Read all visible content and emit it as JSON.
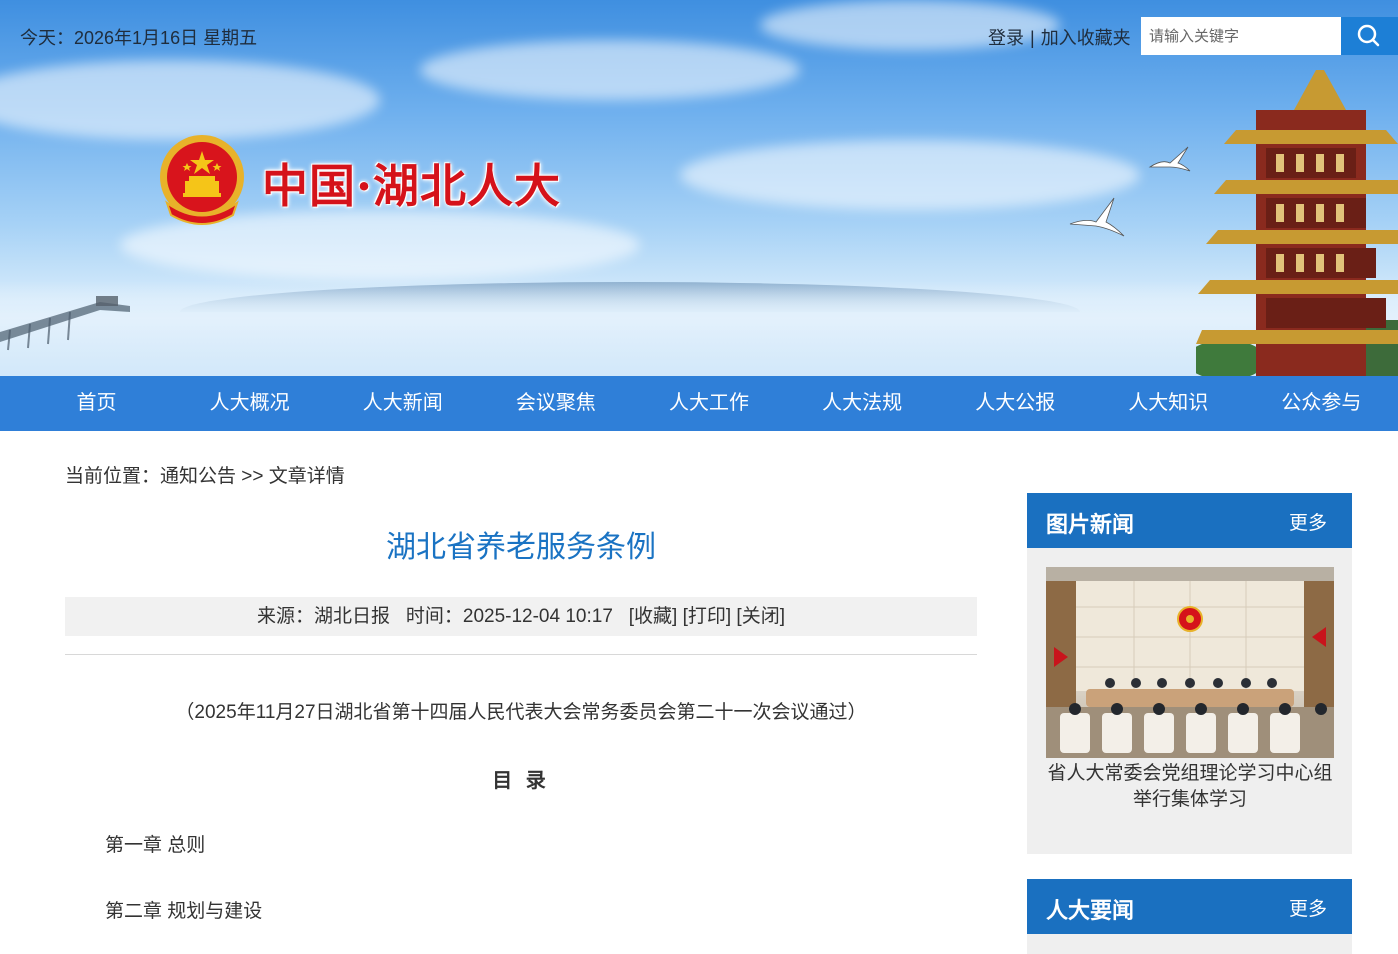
{
  "header": {
    "date": "今天：2026年1月16日 星期五",
    "login": "登录",
    "separator": "|",
    "favorite": "加入收藏夹",
    "search_placeholder": "请输入关键字",
    "site_title": "中国·湖北人大"
  },
  "nav": {
    "items": [
      "首页",
      "人大概况",
      "人大新闻",
      "会议聚焦",
      "人大工作",
      "人大法规",
      "人大公报",
      "人大知识",
      "公众参与"
    ]
  },
  "breadcrumb": {
    "prefix": "当前位置：",
    "section": "通知公告",
    "arrow": " >> ",
    "current": "文章详情"
  },
  "article": {
    "title": "湖北省养老服务条例",
    "source": "来源：湖北日报",
    "time": "时间：2025-12-04 10:17",
    "actions": [
      "[收藏]",
      "[打印]",
      "[关闭]"
    ],
    "passed_note": "（2025年11月27日湖北省第十四届人民代表大会常务委员会第二十一次会议通过）",
    "toc_heading": "目 录",
    "chapters": [
      "第一章 总则",
      "第二章 规划与建设"
    ]
  },
  "sidebar": {
    "photo_news": {
      "title": "图片新闻",
      "more": "更多",
      "caption": "省人大常委会党组理论学习中心组举行集体学习"
    },
    "npc_news": {
      "title": "人大要闻",
      "more": "更多"
    }
  },
  "colors": {
    "nav_bg": "#2f7fd8",
    "side_head_bg": "#1a70c0",
    "title_blue": "#1a73c3",
    "site_title_red": "#d5121a"
  }
}
